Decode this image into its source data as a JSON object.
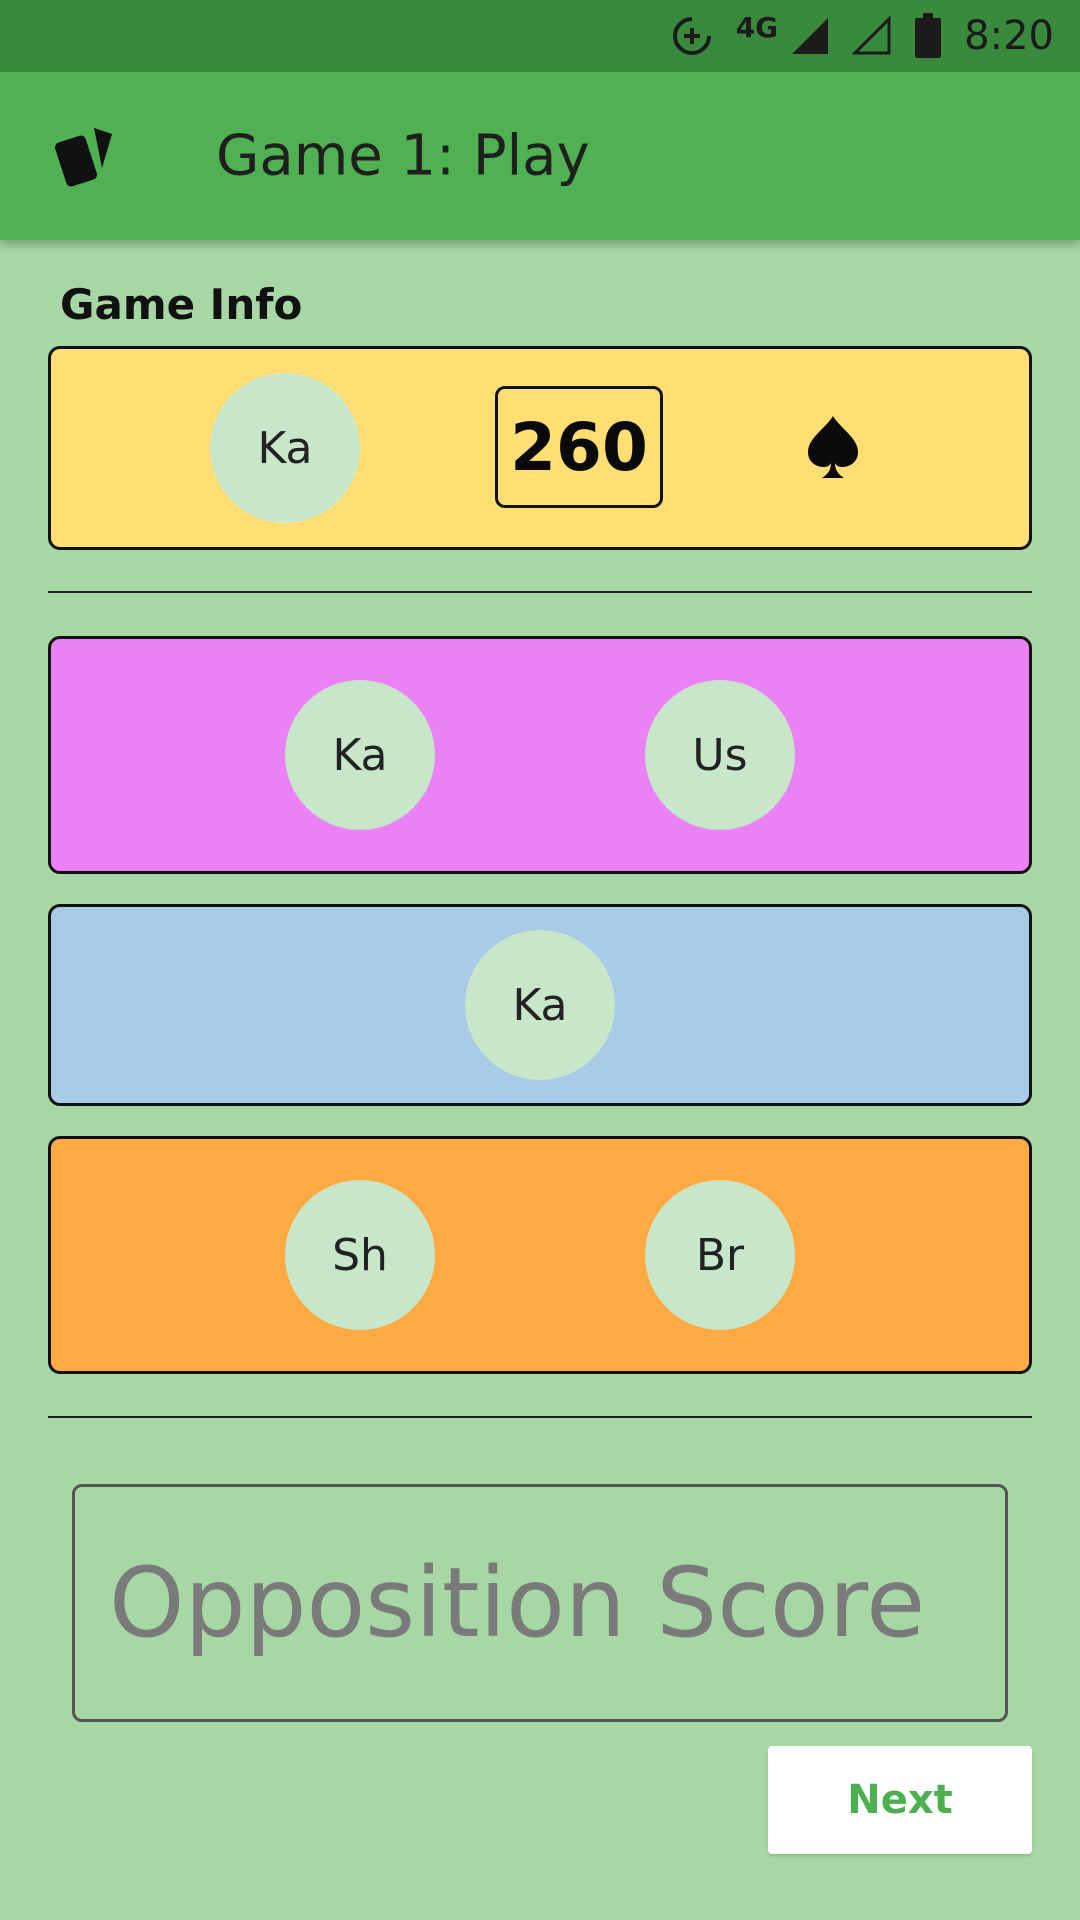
{
  "status_bar": {
    "network": "4G",
    "time": "8:20",
    "icons": [
      "data-saver-icon",
      "signal-icon",
      "signal-empty-icon",
      "battery-icon"
    ]
  },
  "app_bar": {
    "icon": "cards-icon",
    "title": "Game 1: Play"
  },
  "game_info": {
    "label": "Game Info",
    "bidder": "Ka",
    "bid": "260",
    "trump_suit": "spade-icon"
  },
  "teams": [
    {
      "color": "#ea82f6",
      "players": [
        "Ka",
        "Us"
      ]
    },
    {
      "color": "#aacbe8",
      "players": [
        "Ka"
      ]
    },
    {
      "color": "#ffaa42",
      "players": [
        "Sh",
        "Br"
      ]
    }
  ],
  "score_input": {
    "placeholder": "Opposition Score",
    "value": ""
  },
  "actions": {
    "next_label": "Next"
  },
  "colors": {
    "background": "#a8d7a6",
    "app_bar": "#4fb152",
    "status_bar": "#3a8a3e",
    "info_card": "#ffdf74",
    "avatar": "#c8e6c9",
    "accent": "#4caf50"
  }
}
